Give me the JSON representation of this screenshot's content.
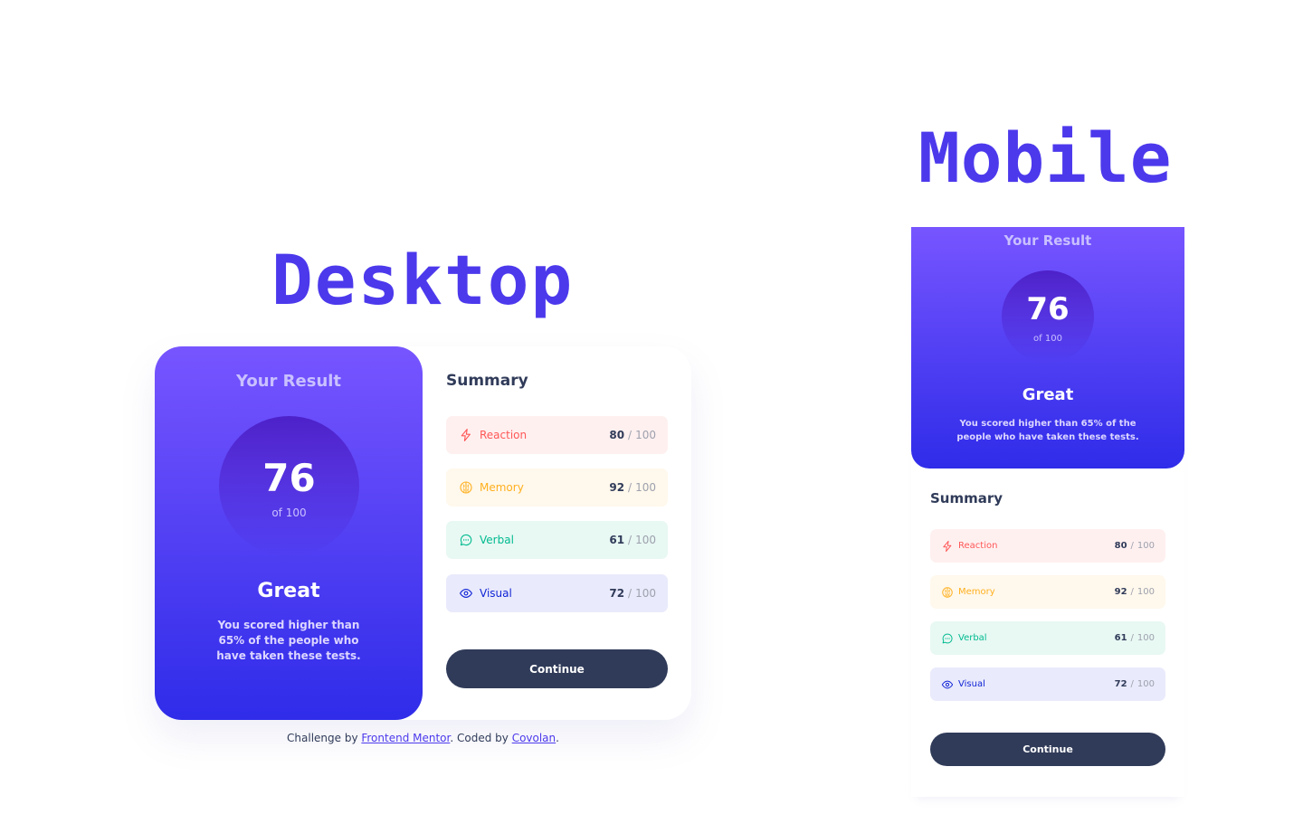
{
  "headings": {
    "desktop": "Desktop",
    "mobile": "Mobile"
  },
  "result": {
    "title": "Your Result",
    "score": "76",
    "of": "of 100",
    "verdict": "Great",
    "description": "You scored higher than 65% of the people who have taken these tests."
  },
  "summary": {
    "title": "Summary",
    "total_label": "100",
    "separator": "/",
    "items": [
      {
        "label": "Reaction",
        "score": "80",
        "icon": "lightning-icon",
        "color": "#ff5757",
        "bg": "#fff0f0"
      },
      {
        "label": "Memory",
        "score": "92",
        "icon": "brain-icon",
        "color": "#ffb01f",
        "bg": "#fff8ec"
      },
      {
        "label": "Verbal",
        "score": "61",
        "icon": "chat-bubble-icon",
        "color": "#00bb8f",
        "bg": "#e8f8f3"
      },
      {
        "label": "Visual",
        "score": "72",
        "icon": "eye-icon",
        "color": "#1125d6",
        "bg": "#e9eafb"
      }
    ]
  },
  "continue_label": "Continue",
  "attribution": {
    "prefix": "Challenge by ",
    "link1": "Frontend Mentor",
    "middle": ". Coded by ",
    "link2": "Covolan",
    "suffix": "."
  },
  "colors": {
    "accent": "#4c39ec",
    "dark": "#303b59",
    "gradient_start": "#7755ff",
    "gradient_end": "#2f2ce9"
  }
}
